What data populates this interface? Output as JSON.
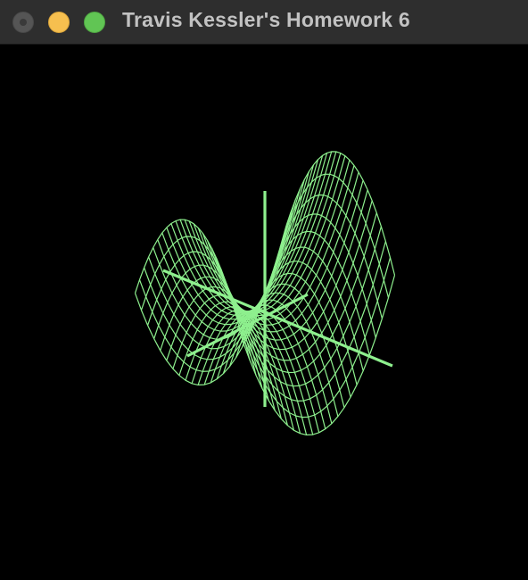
{
  "window": {
    "title": "Travis Kessler's Homework 6",
    "buttons": {
      "close": "close",
      "minimize": "minimize",
      "zoom": "zoom"
    }
  },
  "scene": {
    "object": "saddle wireframe surface with coordinate axes",
    "background_color": "#000000",
    "mesh_color": "#8ef08e",
    "axis_color": "#8ef08e"
  }
}
